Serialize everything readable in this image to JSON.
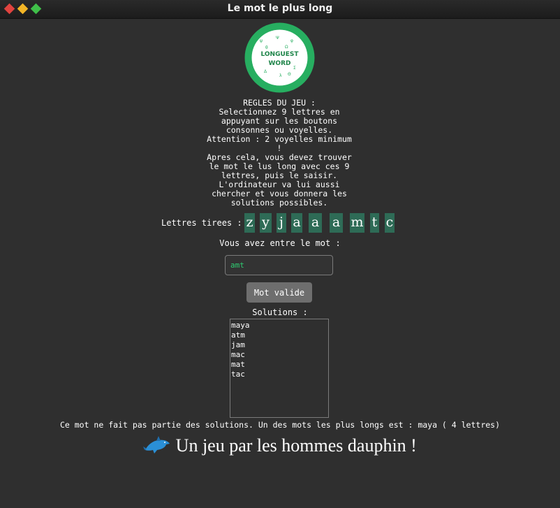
{
  "window": {
    "title": "Le mot le plus long"
  },
  "logo": {
    "line1": "LONGUEST",
    "line2": "WORD",
    "ring_color": "#27ae60"
  },
  "rules": {
    "text": "REGLES DU JEU :\nSelectionnez 9 lettres en\nappuyant sur les boutons\nconsonnes ou voyelles.\nAttention : 2 voyelles minimum\n!\nApres cela, vous devez trouver\nle mot le lus long avec ces 9\nlettres, puis le saisir.\nL'ordinateur va lui aussi\nchercher et vous donnera les\nsolutions possibles."
  },
  "letters": {
    "label": "Lettres tirees :",
    "tiles": [
      "z",
      "y",
      "j",
      "a",
      "a",
      "a",
      "m",
      "t",
      "c"
    ],
    "tile_color": "#2e6b56"
  },
  "entry": {
    "label": "Vous avez entre le mot :",
    "value": "amt"
  },
  "validate_button": {
    "label": "Mot valide"
  },
  "solutions": {
    "label": "Solutions :",
    "items": [
      "maya",
      "atm",
      "jam",
      "mac",
      "mat",
      "tac"
    ]
  },
  "result": {
    "text": "Ce mot ne fait pas partie des solutions. Un des mots les plus longs est : maya ( 4 lettres)"
  },
  "footer": {
    "text": "Un jeu par les hommes dauphin !",
    "icon": "dolphin-icon"
  }
}
